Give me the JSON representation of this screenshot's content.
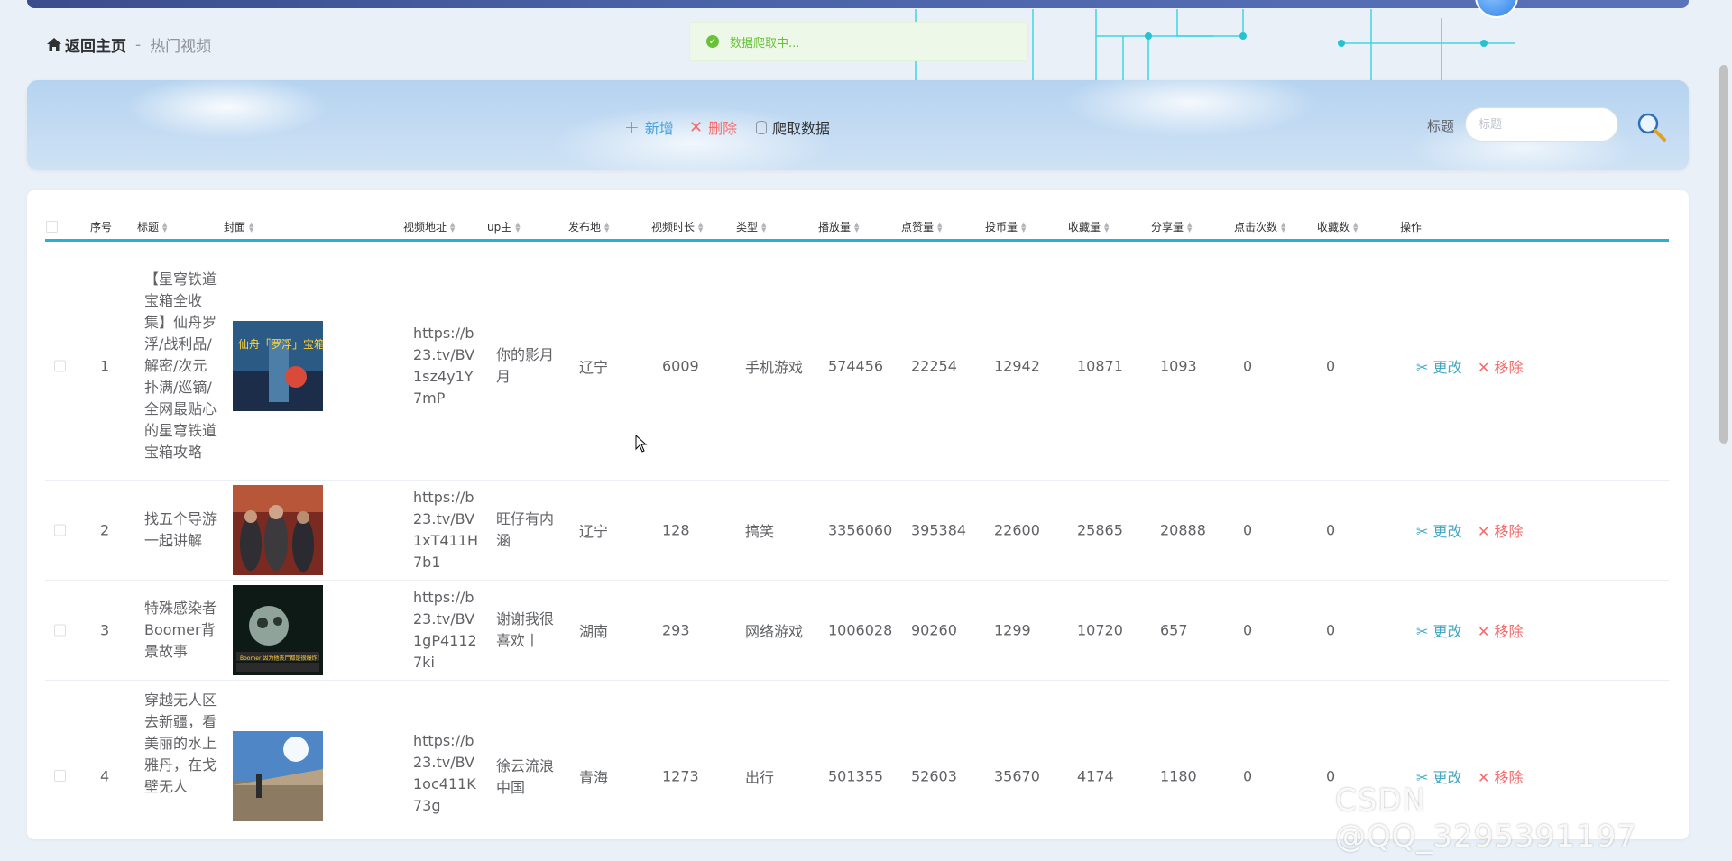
{
  "breadcrumb": {
    "home_label": "返回主页",
    "separator": "-",
    "current": "热门视频"
  },
  "toast": {
    "message": "数据爬取中..."
  },
  "toolbar": {
    "add_label": "新增",
    "delete_label": "删除",
    "crawl_label": "爬取数据",
    "search_label": "标题",
    "search_placeholder": "标题",
    "search_value": ""
  },
  "table": {
    "columns": {
      "index": "序号",
      "title": "标题",
      "cover": "封面",
      "url": "视频地址",
      "up": "up主",
      "location": "发布地",
      "duration": "视频时长",
      "type": "类型",
      "plays": "播放量",
      "likes": "点赞量",
      "coins": "投币量",
      "favorites": "收藏量",
      "shares": "分享量",
      "clicks": "点击次数",
      "stores": "收藏数",
      "ops": "操作"
    },
    "rows": [
      {
        "index": "1",
        "title": "【星穹铁道宝箱全收集】仙舟罗浮/战利品/解密/次元扑满/巡镝/全网最贴心的星穹铁道宝箱攻略",
        "url": "https://b23.tv/BV1sz4y1Y7mP",
        "up": "你的影月月",
        "location": "辽宁",
        "duration": "6009",
        "type": "手机游戏",
        "plays": "574456",
        "likes": "22254",
        "coins": "12942",
        "favorites": "10871",
        "shares": "1093",
        "clicks": "0",
        "stores": "0",
        "cover_text": "仙舟「罗浮」宝箱全收集"
      },
      {
        "index": "2",
        "title": "找五个导游 一起讲解",
        "url": "https://b23.tv/BV1xT411H7b1",
        "up": "旺仔有内涵",
        "location": "辽宁",
        "duration": "128",
        "type": "搞笑",
        "plays": "3356060",
        "likes": "395384",
        "coins": "22600",
        "favorites": "25865",
        "shares": "20888",
        "clicks": "0",
        "stores": "0",
        "cover_text": ""
      },
      {
        "index": "3",
        "title": "特殊感染者Boomer背景故事",
        "url": "https://b23.tv/BV1gP41127ki",
        "up": "谢谢我很喜欢丨",
        "location": "湖南",
        "duration": "293",
        "type": "网络游戏",
        "plays": "1006028",
        "likes": "90260",
        "coins": "1299",
        "favorites": "10720",
        "shares": "657",
        "clicks": "0",
        "stores": "0",
        "cover_text": "Boomer 因为他丧尸都是很爆炸！"
      },
      {
        "index": "4",
        "title": "穿越无人区去新疆，看美丽的水上雅丹，在戈壁无人",
        "url": "https://b23.tv/BV1oc411K73g",
        "up": "徐云流浪中国",
        "location": "青海",
        "duration": "1273",
        "type": "出行",
        "plays": "501355",
        "likes": "52603",
        "coins": "35670",
        "favorites": "4174",
        "shares": "1180",
        "clicks": "0",
        "stores": "0",
        "cover_text": ""
      }
    ],
    "edit_label": "更改",
    "remove_label": "移除"
  },
  "watermark": "CSDN @QQ_3295391197",
  "colors": {
    "accent": "#2aaed8",
    "add": "#4aa3d8",
    "danger": "#f56c6c",
    "edit": "#44a8c4",
    "success": "#67c23a"
  },
  "icons": {
    "home": "home-icon",
    "add": "plus-icon",
    "delete": "close-icon",
    "crawl": "database-icon",
    "search": "magnifier-icon",
    "edit": "scissors-icon",
    "remove": "close-icon",
    "toast": "check-circle-icon"
  }
}
